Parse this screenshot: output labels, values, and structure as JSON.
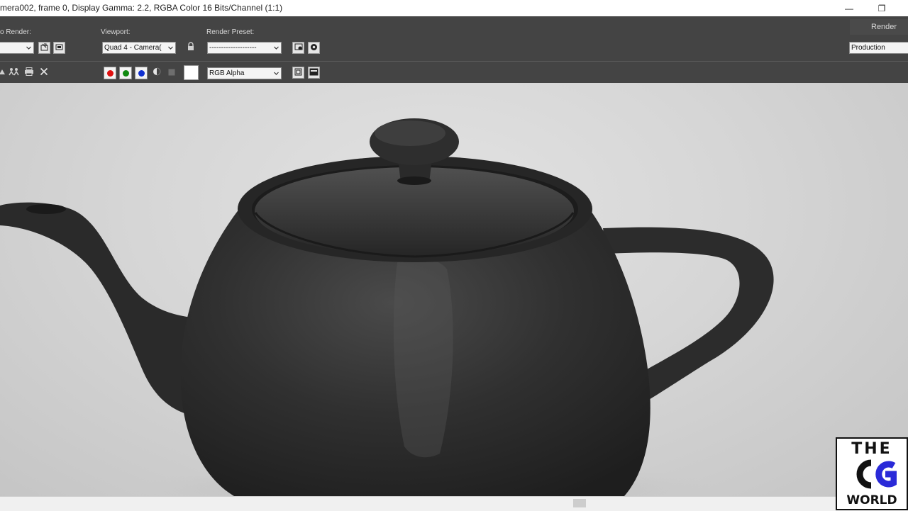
{
  "window": {
    "title": "mera002, frame 0, Display Gamma: 2.2, RGBA Color 16 Bits/Channel (1:1)",
    "controls": {
      "minimize": "—",
      "restore": "❐"
    }
  },
  "toolbar": {
    "area_to_render": {
      "label": "o Render:",
      "value": ""
    },
    "viewport": {
      "label": "Viewport:",
      "value": "Quad 4 - Camera("
    },
    "render_preset": {
      "label": "Render Preset:",
      "value": "--------------------"
    },
    "render_button": "Render",
    "production": "Production",
    "display_channel": "RGB Alpha",
    "channels": [
      {
        "name": "red-channel",
        "color": "#e01010"
      },
      {
        "name": "green-channel",
        "color": "#108a10"
      },
      {
        "name": "blue-channel",
        "color": "#1030d0"
      }
    ]
  },
  "watermark": {
    "line1": "THE",
    "line2": "CG",
    "line3": "WORLD"
  },
  "scene": {
    "subject": "teapot-render"
  }
}
